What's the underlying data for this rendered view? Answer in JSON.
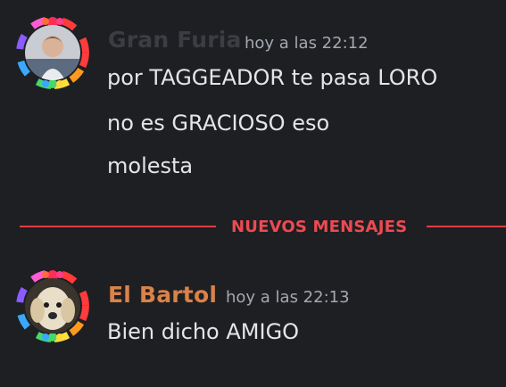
{
  "messages": [
    {
      "username": "Gran Furia",
      "username_color": "#3b3d42",
      "timestamp": "hoy a las 22:12",
      "lines": [
        "por TAGGEADOR te pasa LORO",
        "no es GRACIOSO eso",
        "molesta"
      ],
      "avatar_icon": "avatar-person-photo"
    },
    {
      "username": "El Bartol",
      "username_color": "#d9824a",
      "timestamp": "hoy a las 22:13",
      "lines": [
        "Bien dicho AMIGO"
      ],
      "avatar_icon": "avatar-dog-photo"
    }
  ],
  "divider": {
    "label": "NUEVOS MENSAJES",
    "color": "#e23d45"
  },
  "avatar_decoration": "rainbow-flower-wreath"
}
